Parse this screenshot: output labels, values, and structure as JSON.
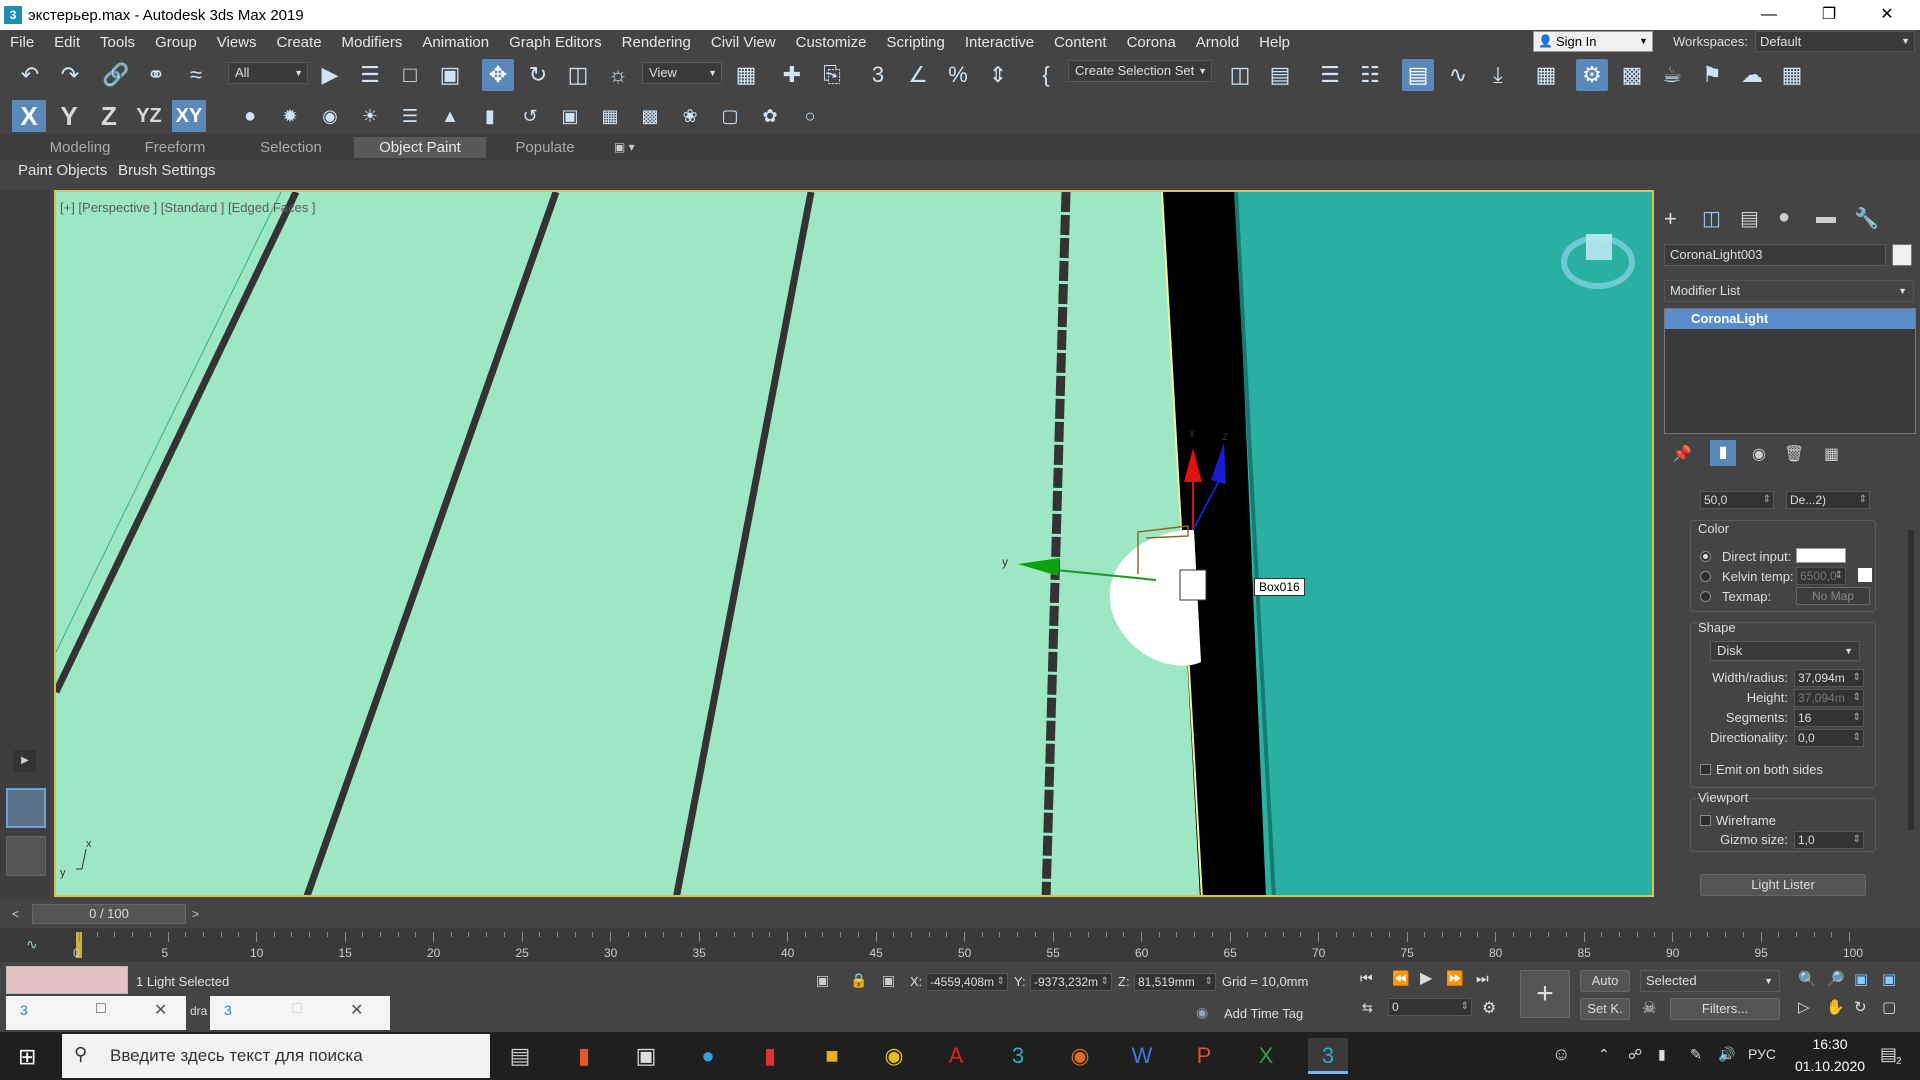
{
  "window": {
    "title": "экстерьер.max - Autodesk 3ds Max 2019",
    "app_icon": "3"
  },
  "menu": [
    "File",
    "Edit",
    "Tools",
    "Group",
    "Views",
    "Create",
    "Modifiers",
    "Animation",
    "Graph Editors",
    "Rendering",
    "Civil View",
    "Customize",
    "Scripting",
    "Interactive",
    "Content",
    "Corona",
    "Arnold",
    "Help"
  ],
  "account": {
    "signin": "Sign In",
    "workspaces_label": "Workspaces:",
    "workspace": "Default"
  },
  "toolbar": {
    "filter": "All",
    "ref_coord": "View",
    "selection_set": "Create Selection Set",
    "axis_x": "X",
    "axis_y": "Y",
    "axis_z": "Z",
    "axis_yz": "YZ",
    "axis_xy": "XY"
  },
  "ribbon": {
    "tabs": [
      "Modeling",
      "Freeform",
      "Selection",
      "Object Paint",
      "Populate"
    ],
    "active": "Object Paint",
    "sub": [
      "Paint Objects",
      "Brush Settings"
    ]
  },
  "viewport": {
    "label": "[+] [Perspective ] [Standard ] [Edged Faces ]",
    "object_tooltip": "Box016",
    "gizmo": {
      "x": "x",
      "y": "y",
      "z": "z"
    },
    "corner_axis": {
      "x": "x",
      "y": "y"
    }
  },
  "command_panel": {
    "object_name": "CoronaLight003",
    "modifier_list": "Modifier List",
    "stack_item": "CoronaLight",
    "top_spinner": "50,0",
    "top_dd": "De...2)",
    "color_group": "Color",
    "direct_input": "Direct input:",
    "kelvin": "Kelvin temp:",
    "kelvin_value": "6500,0",
    "texmap": "Texmap:",
    "no_map": "No Map",
    "shape_group": "Shape",
    "shape": "Disk",
    "width_label": "Width/radius:",
    "width_value": "37,094m",
    "height_label": "Height:",
    "height_value": "37,094m",
    "segments_label": "Segments:",
    "segments_value": "16",
    "directionality_label": "Directionality:",
    "directionality_value": "0,0",
    "emit_both": "Emit on both sides",
    "viewport_group": "Viewport",
    "wireframe": "Wireframe",
    "gizmo_label": "Gizmo size:",
    "gizmo_value": "1,0",
    "light_lister": "Light Lister"
  },
  "timeline": {
    "frame": "0 / 100",
    "ticks": [
      "0",
      "5",
      "10",
      "15",
      "20",
      "25",
      "30",
      "35",
      "40",
      "45",
      "50",
      "55",
      "60",
      "65",
      "70",
      "75",
      "80",
      "85",
      "90",
      "95",
      "100"
    ]
  },
  "status": {
    "selected": "1 Light Selected",
    "x_label": "X:",
    "x": "-4559,408m",
    "y_label": "Y:",
    "y": "-9373,232m",
    "z_label": "Z:",
    "z": "81,519mm",
    "grid": "Grid = 10,0mm",
    "add_time_tag": "Add Time Tag",
    "auto": "Auto",
    "set_key": "Set K.",
    "selected_dd": "Selected",
    "filters": "Filters...",
    "frame_field": "0",
    "mini_text": "dra"
  },
  "taskbar": {
    "search": "Введите здесь текст для поиска",
    "lang": "РУС",
    "time": "16:30",
    "date": "01.10.2020",
    "notify": "2"
  }
}
